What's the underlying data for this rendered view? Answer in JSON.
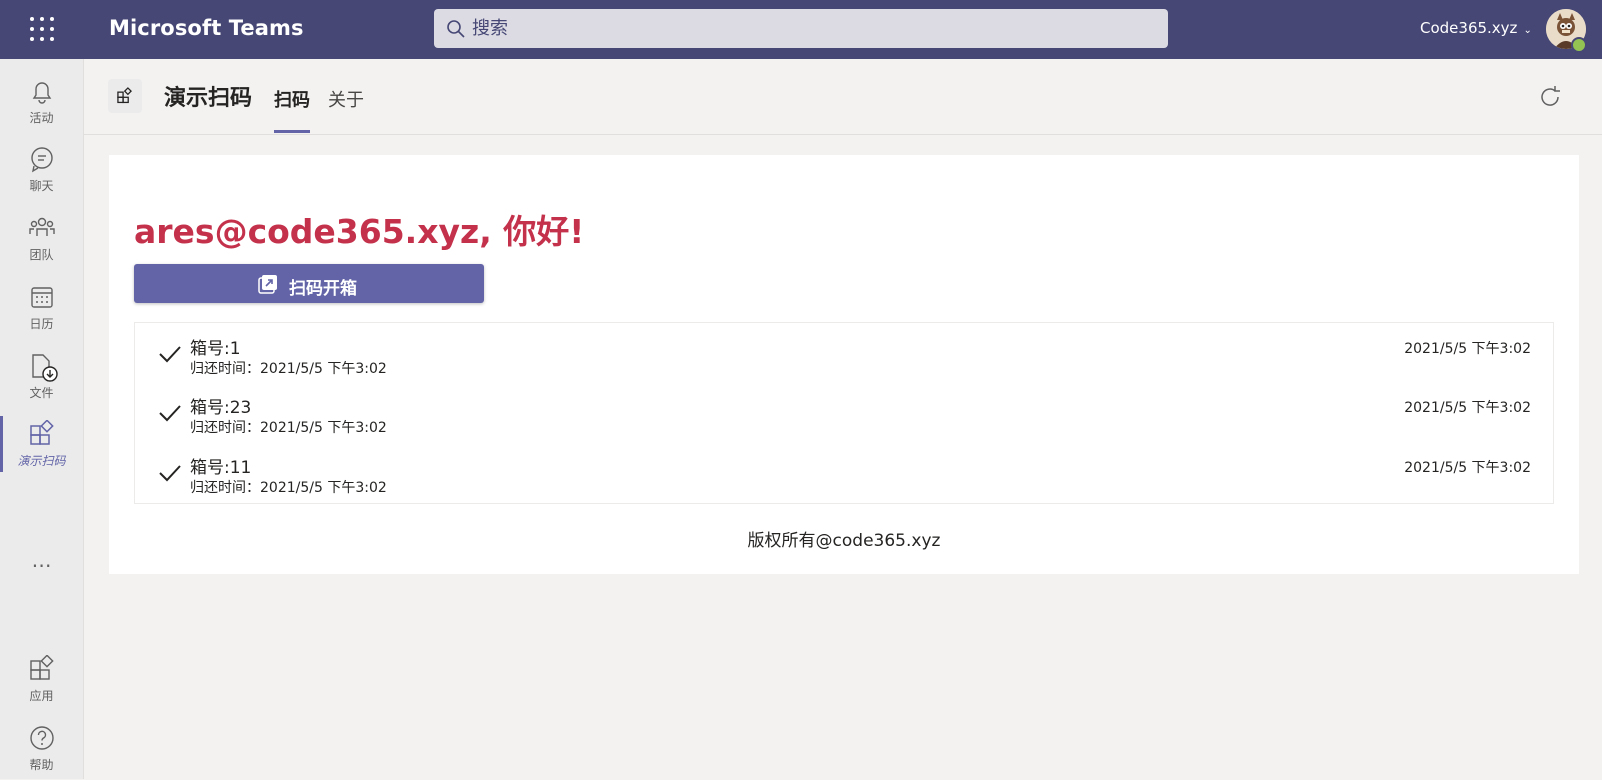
{
  "topbar": {
    "app_name": "Microsoft Teams",
    "search_placeholder": "搜索",
    "account_name": "Code365.xyz",
    "bg_color": "#464775"
  },
  "rail": {
    "items": [
      {
        "label": "活动",
        "icon": "bell-icon"
      },
      {
        "label": "聊天",
        "icon": "chat-icon"
      },
      {
        "label": "团队",
        "icon": "teams-icon"
      },
      {
        "label": "日历",
        "icon": "calendar-icon"
      },
      {
        "label": "文件",
        "icon": "file-icon"
      },
      {
        "label": "演示扫码",
        "icon": "app-icon",
        "active": true
      }
    ],
    "bottom_items": [
      {
        "label": "应用",
        "icon": "apps-icon"
      },
      {
        "label": "帮助",
        "icon": "help-icon"
      }
    ]
  },
  "app_header": {
    "title": "演示扫码",
    "tabs": [
      {
        "label": "扫码",
        "active": true
      },
      {
        "label": "关于",
        "active": false
      }
    ]
  },
  "main": {
    "greeting": "ares@code365.xyz, 你好!",
    "scan_button_label": "扫码开箱",
    "records": [
      {
        "title": "箱号:1",
        "subtitle": "归还时间：2021/5/5 下午3:02",
        "time": "2021/5/5 下午3:02"
      },
      {
        "title": "箱号:23",
        "subtitle": "归还时间：2021/5/5 下午3:02",
        "time": "2021/5/5 下午3:02"
      },
      {
        "title": "箱号:11",
        "subtitle": "归还时间：2021/5/5 下午3:02",
        "time": "2021/5/5 下午3:02"
      }
    ],
    "footer": "版权所有@code365.xyz"
  },
  "colors": {
    "accent": "#6264a7",
    "greeting": "#c4314b"
  }
}
